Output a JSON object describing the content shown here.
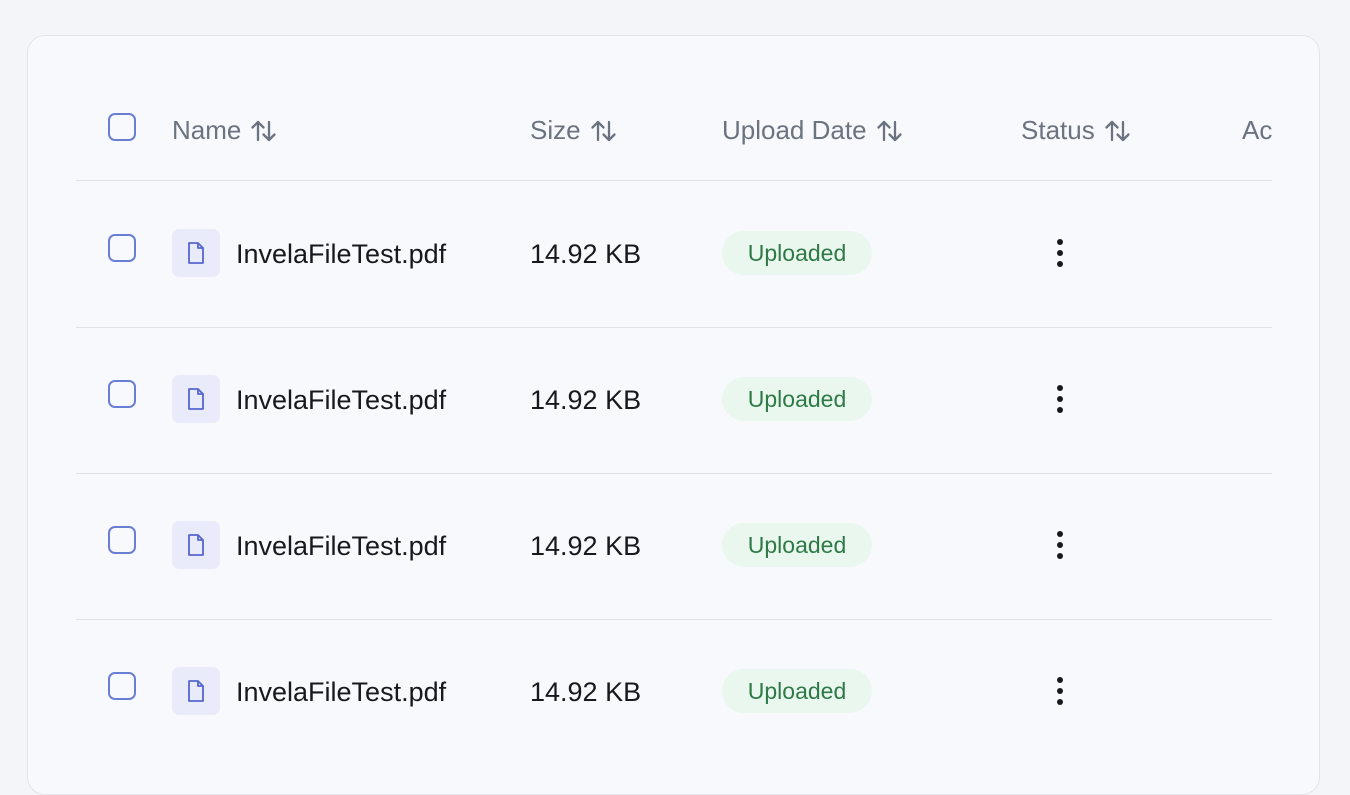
{
  "table": {
    "columns": [
      {
        "label": "Name",
        "sortable": true
      },
      {
        "label": "Size",
        "sortable": true
      },
      {
        "label": "Upload Date",
        "sortable": true
      },
      {
        "label": "Status",
        "sortable": true
      },
      {
        "label": "Ac"
      }
    ],
    "rows": [
      {
        "name": "InvelaFileTest.pdf",
        "size": "14.92 KB",
        "status": "Uploaded"
      },
      {
        "name": "InvelaFileTest.pdf",
        "size": "14.92 KB",
        "status": "Uploaded"
      },
      {
        "name": "InvelaFileTest.pdf",
        "size": "14.92 KB",
        "status": "Uploaded"
      },
      {
        "name": "InvelaFileTest.pdf",
        "size": "14.92 KB",
        "status": "Uploaded"
      }
    ]
  },
  "icons": {
    "file": "file-icon",
    "sort": "sort-arrows-icon",
    "menu": "more-vertical-icon"
  },
  "colors": {
    "checkbox_border": "#6a7fd4",
    "badge_bg": "#eaf7ee",
    "badge_text": "#2d7a47",
    "icon_bg": "#eaebfa",
    "icon_stroke": "#5566cf"
  }
}
